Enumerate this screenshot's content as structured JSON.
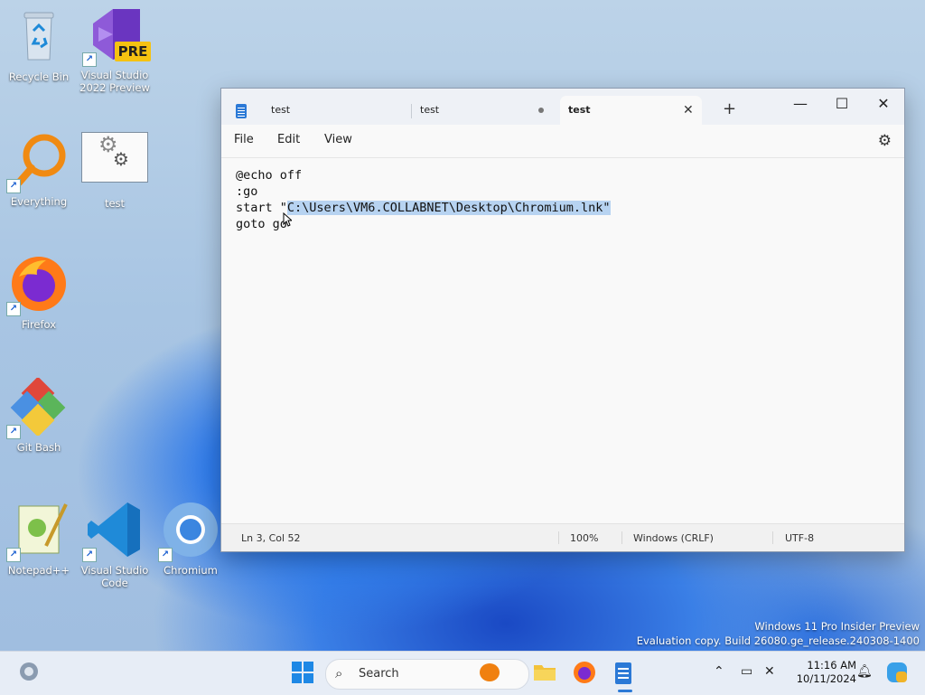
{
  "desktop": {
    "icons": [
      {
        "label": "Recycle Bin"
      },
      {
        "label": "Visual Studio 2022 Preview",
        "badge": "PRE"
      },
      {
        "label": "Everything"
      },
      {
        "label": "test"
      },
      {
        "label": "Firefox"
      },
      {
        "label": "Git Bash"
      },
      {
        "label": "Notepad++"
      },
      {
        "label": "Visual Studio Code"
      },
      {
        "label": "Chromium"
      }
    ],
    "watermark": {
      "line1": "Windows 11 Pro Insider Preview",
      "line2": "Evaluation copy. Build 26080.ge_release.240308-1400"
    }
  },
  "notepad": {
    "tabs": [
      {
        "label": "test",
        "state": "inactive"
      },
      {
        "label": "test",
        "state": "modified"
      },
      {
        "label": "test",
        "state": "active"
      }
    ],
    "new_tab": "+",
    "window_controls": {
      "minimize": "—",
      "maximize": "☐",
      "close": "✕"
    },
    "menu": {
      "file": "File",
      "edit": "Edit",
      "view": "View"
    },
    "lines": {
      "l1": "@echo off",
      "l2": ":go",
      "l3_pre": "start \"",
      "l3_sel": "C:\\Users\\VM6.COLLABNET\\Desktop\\Chromium.lnk\"",
      "l4": "goto go"
    },
    "status": {
      "position": "Ln 3, Col 52",
      "zoom": "100%",
      "line_ending": "Windows (CRLF)",
      "encoding": "UTF-8"
    }
  },
  "taskbar": {
    "search_label": "Search",
    "time": "11:16 AM",
    "date": "10/11/2024"
  },
  "colors": {
    "accent": "#2b79d6",
    "selection": "#b7d3f1"
  }
}
